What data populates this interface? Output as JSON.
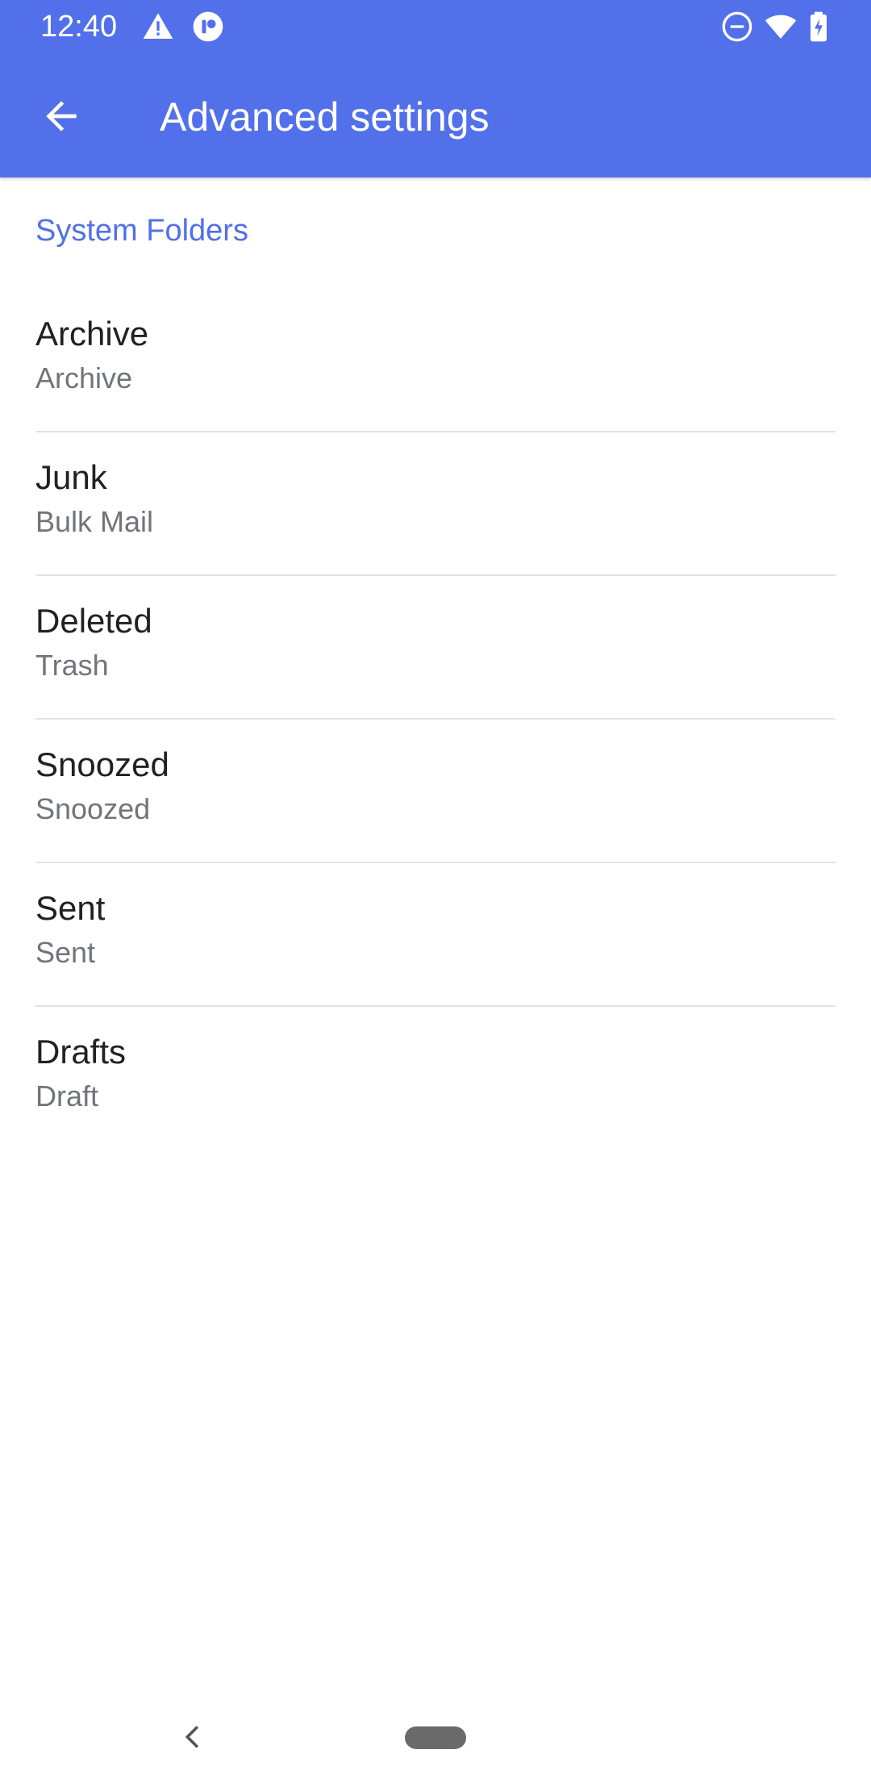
{
  "colors": {
    "app_bar": "#5170ea",
    "accent": "#5170ea",
    "title_text": "#202124",
    "summary_text": "#70757a",
    "divider": "#e3e3e3"
  },
  "status_bar": {
    "time": "12:40",
    "icons": [
      "alert-icon",
      "app-notification-icon",
      "do-not-disturb-icon",
      "wifi-icon",
      "battery-charging-icon"
    ]
  },
  "app_bar": {
    "back_icon": "arrow-back-icon",
    "title": "Advanced settings"
  },
  "section": {
    "header": "System Folders"
  },
  "folders": [
    {
      "title": "Archive",
      "summary": "Archive"
    },
    {
      "title": "Junk",
      "summary": "Bulk Mail"
    },
    {
      "title": "Deleted",
      "summary": "Trash"
    },
    {
      "title": "Snoozed",
      "summary": "Snoozed"
    },
    {
      "title": "Sent",
      "summary": "Sent"
    },
    {
      "title": "Drafts",
      "summary": "Draft"
    }
  ],
  "nav_bar": {
    "back_icon": "nav-back-icon",
    "home_icon": "home-pill-icon"
  }
}
